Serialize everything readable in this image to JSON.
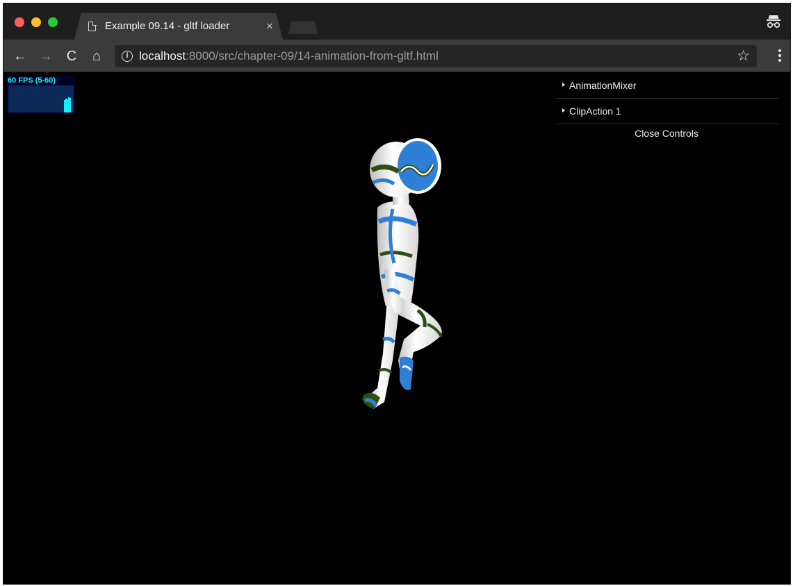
{
  "window": {
    "tab": {
      "title": "Example 09.14 - gltf loader",
      "close_glyph": "×"
    }
  },
  "toolbar": {
    "back_glyph": "←",
    "forward_glyph": "→",
    "reload_glyph": "C",
    "home_glyph": "⌂",
    "info_glyph": "i",
    "url_host": "localhost",
    "url_path": ":8000/src/chapter-09/14-animation-from-gltf.html",
    "star_glyph": "☆"
  },
  "stats": {
    "label": "60 FPS (5-60)",
    "color": "#10f0ff"
  },
  "gui": {
    "folders": [
      {
        "label": "AnimationMixer"
      },
      {
        "label": "ClipAction 1"
      }
    ],
    "close_label": "Close Controls"
  },
  "scene": {
    "model_colors": {
      "body": "#f4f4f4",
      "stripe_blue": "#2f7fd6",
      "stripe_green": "#2d4f12"
    }
  },
  "icons": [
    "page-icon",
    "close-icon",
    "incognito-icon",
    "back-arrow-icon",
    "forward-arrow-icon",
    "reload-icon",
    "home-icon",
    "info-icon",
    "bookmark-star-icon",
    "menu-dots-icon",
    "disclosure-triangle-icon"
  ]
}
